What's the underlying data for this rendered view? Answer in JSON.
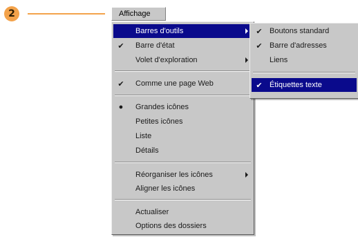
{
  "callout": {
    "number": "2",
    "color": "#f3a24a"
  },
  "menubar": {
    "label": "Affichage"
  },
  "main_menu": {
    "items": [
      {
        "label": "Barres d'outils",
        "check": "",
        "submenu": true
      },
      {
        "label": "Barre d'état",
        "check": "✔",
        "submenu": false
      },
      {
        "label": "Volet d'exploration",
        "check": "",
        "submenu": true
      },
      {
        "label": "Comme une page Web",
        "check": "✔",
        "submenu": false
      },
      {
        "label": "Grandes icônes",
        "check": "●",
        "submenu": false
      },
      {
        "label": "Petites icônes",
        "check": "",
        "submenu": false
      },
      {
        "label": "Liste",
        "check": "",
        "submenu": false
      },
      {
        "label": "Détails",
        "check": "",
        "submenu": false
      },
      {
        "label": "Réorganiser les icônes",
        "check": "",
        "submenu": true
      },
      {
        "label": "Aligner les icônes",
        "check": "",
        "submenu": false
      },
      {
        "label": "Actualiser",
        "check": "",
        "submenu": false
      },
      {
        "label": "Options des dossiers",
        "check": "",
        "submenu": false
      }
    ]
  },
  "sub_menu": {
    "items": [
      {
        "label": "Boutons standard",
        "check": "✔"
      },
      {
        "label": "Barre d'adresses",
        "check": "✔"
      },
      {
        "label": "Liens",
        "check": ""
      },
      {
        "label": "Étiquettes texte",
        "check": "✔"
      }
    ]
  },
  "colors": {
    "menu_bg": "#c8c8c8",
    "highlight": "#0a0a8c"
  }
}
